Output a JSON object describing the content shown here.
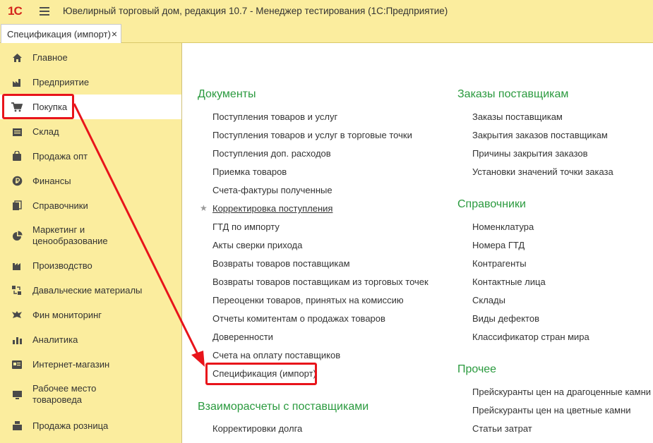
{
  "titlebar": {
    "logo": "1С",
    "title": "Ювелирный торговый дом, редакция 10.7  - Менеджер тестирования (1С:Предприятие)"
  },
  "open_tab": {
    "label": "Спецификация (импорт)",
    "close": "×"
  },
  "sidebar": {
    "items": [
      {
        "label": "Главное",
        "icon": "home-icon"
      },
      {
        "label": "Предприятие",
        "icon": "factory-icon"
      },
      {
        "label": "Покупка",
        "icon": "cart-icon",
        "active": true
      },
      {
        "label": "Склад",
        "icon": "warehouse-icon"
      },
      {
        "label": "Продажа опт",
        "icon": "bag-icon"
      },
      {
        "label": "Финансы",
        "icon": "ruble-icon"
      },
      {
        "label": "Справочники",
        "icon": "books-icon"
      },
      {
        "label": "Маркетинг и\nценообразование",
        "icon": "pie-chart-icon"
      },
      {
        "label": "Производство",
        "icon": "production-icon"
      },
      {
        "label": "Давальческие материалы",
        "icon": "materials-icon"
      },
      {
        "label": "Фин мониторинг",
        "icon": "eagle-icon"
      },
      {
        "label": "Аналитика",
        "icon": "bar-chart-icon"
      },
      {
        "label": "Интернет-магазин",
        "icon": "web-store-icon"
      },
      {
        "label": "Рабочее место\nтовароведа",
        "icon": "workstation-icon"
      },
      {
        "label": "Продажа розница",
        "icon": "cash-register-icon"
      }
    ]
  },
  "content": {
    "documents": {
      "title": "Документы",
      "links": [
        "Поступления товаров и услуг",
        "Поступления товаров и услуг в торговые точки",
        "Поступления доп. расходов",
        "Приемка товаров",
        "Счета-фактуры полученные",
        "Корректировка поступления",
        "ГТД по импорту",
        "Акты сверки прихода",
        "Возвраты товаров поставщикам",
        "Возвраты товаров поставщикам из торговых точек",
        "Переоценки товаров, принятых на комиссию",
        "Отчеты комитентам о продажах товаров",
        "Доверенности",
        "Счета на оплату поставщиков",
        "Спецификация (импорт)"
      ]
    },
    "settlements": {
      "title": "Взаиморасчеты с поставщиками",
      "links": [
        "Корректировки долга"
      ]
    },
    "orders": {
      "title": "Заказы поставщикам",
      "links": [
        "Заказы поставщикам",
        "Закрытия заказов поставщикам",
        "Причины закрытия заказов",
        "Установки значений точки заказа"
      ]
    },
    "references": {
      "title": "Справочники",
      "links": [
        "Номенклатура",
        "Номера ГТД",
        "Контрагенты",
        "Контактные лица",
        "Склады",
        "Виды дефектов",
        "Классификатор стран мира"
      ]
    },
    "other": {
      "title": "Прочее",
      "links": [
        "Прейскуранты цен на драгоценные камни",
        "Прейскуранты цен на цветные камни",
        "Статьи затрат"
      ]
    }
  },
  "colors": {
    "panel_bg": "#fbed9e",
    "section_title": "#2a9a3e",
    "annotation": "#e8141b"
  }
}
